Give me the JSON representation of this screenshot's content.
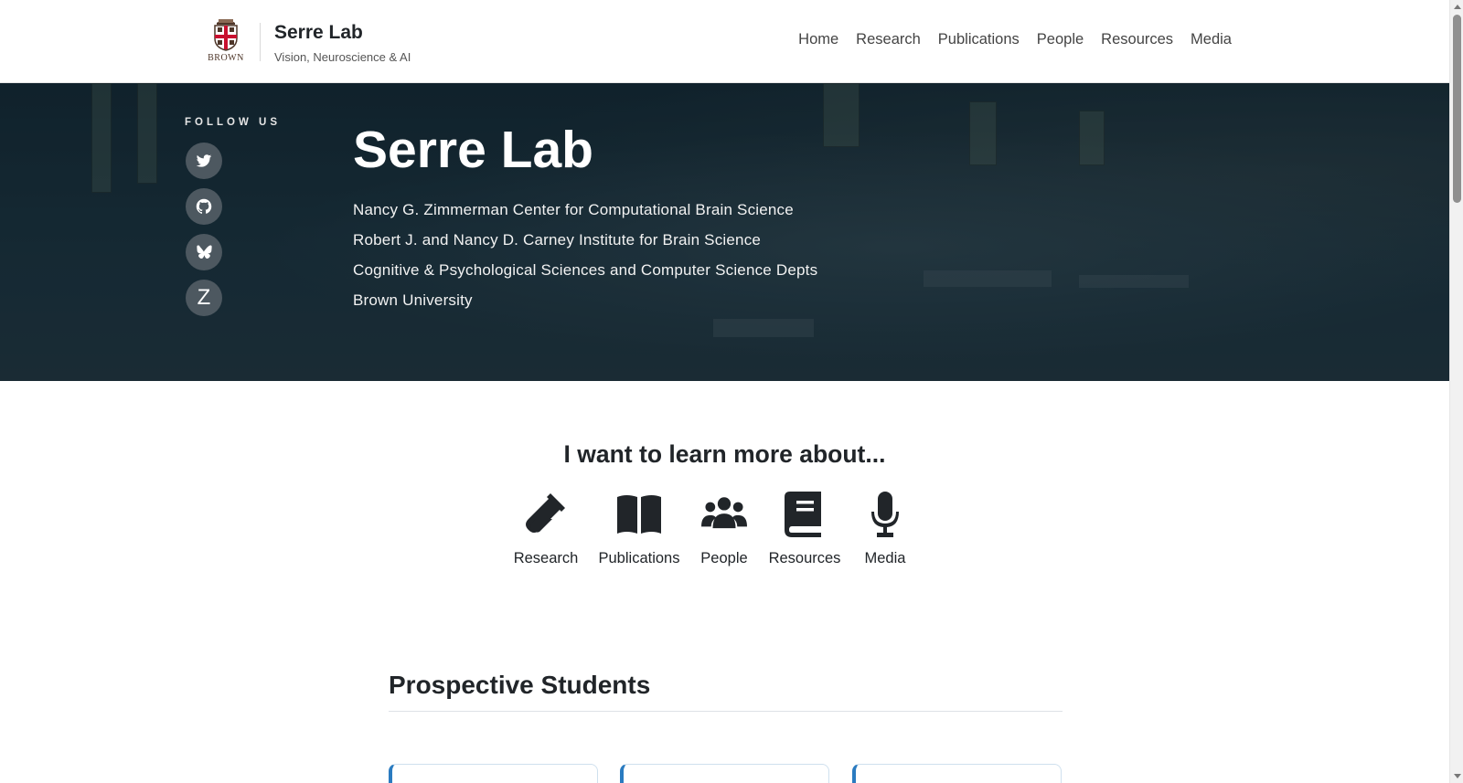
{
  "header": {
    "logo_text": "BROWN",
    "title": "Serre Lab",
    "subtitle": "Vision, Neuroscience & AI",
    "nav": [
      "Home",
      "Research",
      "Publications",
      "People",
      "Resources",
      "Media"
    ]
  },
  "hero": {
    "follow_label": "FOLLOW US",
    "social": [
      "twitter-icon",
      "github-icon",
      "bluesky-icon",
      "zotero-icon"
    ],
    "zotero_letter": "Z",
    "title": "Serre Lab",
    "lines": [
      "Nancy G. Zimmerman Center for Computational Brain Science",
      "Robert J. and Nancy D. Carney Institute for Brain Science",
      "Cognitive & Psychological Sciences and Computer Science Depts",
      "Brown University"
    ]
  },
  "learn": {
    "title": "I want to learn more about...",
    "items": [
      {
        "label": "Research",
        "icon": "flask-icon"
      },
      {
        "label": "Publications",
        "icon": "book-open-icon"
      },
      {
        "label": "People",
        "icon": "users-icon"
      },
      {
        "label": "Resources",
        "icon": "book-icon"
      },
      {
        "label": "Media",
        "icon": "microphone-icon"
      }
    ]
  },
  "prospective": {
    "title": "Prospective Students"
  }
}
